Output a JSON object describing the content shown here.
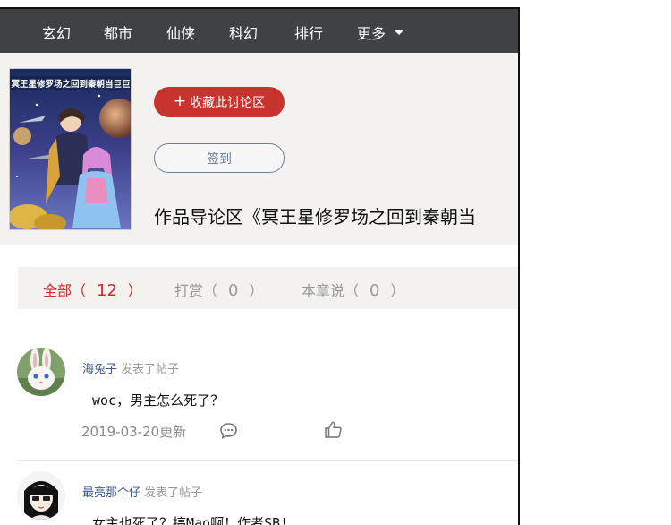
{
  "nav": {
    "items": [
      "玄幻",
      "都市",
      "仙侠",
      "科幻",
      "排行",
      "更多"
    ]
  },
  "book": {
    "cover_title": "冥王星修罗场之回到秦朝当巨巨",
    "favorite_label": "收藏此讨论区",
    "favorite_plus": "+",
    "signin_label": "签到",
    "forum_title": "作品导论区《冥王星修罗场之回到秦朝当"
  },
  "tabs": [
    {
      "label": "全部（",
      "count": "12",
      "close": "）",
      "active": true
    },
    {
      "label": "打赏（",
      "count": "0",
      "close": "）",
      "active": false
    },
    {
      "label": "本章说（",
      "count": "0",
      "close": "）",
      "active": false
    }
  ],
  "posts": [
    {
      "author": "海兔子",
      "action": "发表了帖子",
      "content": "woc，男主怎么死了？",
      "date": "2019-03-20更新"
    },
    {
      "author": "最亮那个仔",
      "action": "发表了帖子",
      "content": "女主也死了？搞Mao啊！作者SB!"
    }
  ],
  "colors": {
    "nav_bg": "#404145",
    "accent_red": "#c8332e",
    "author_blue": "#3c5a8c"
  },
  "icons": [
    "chevron-down-icon",
    "plus-icon",
    "comment-icon",
    "thumbs-up-icon"
  ]
}
